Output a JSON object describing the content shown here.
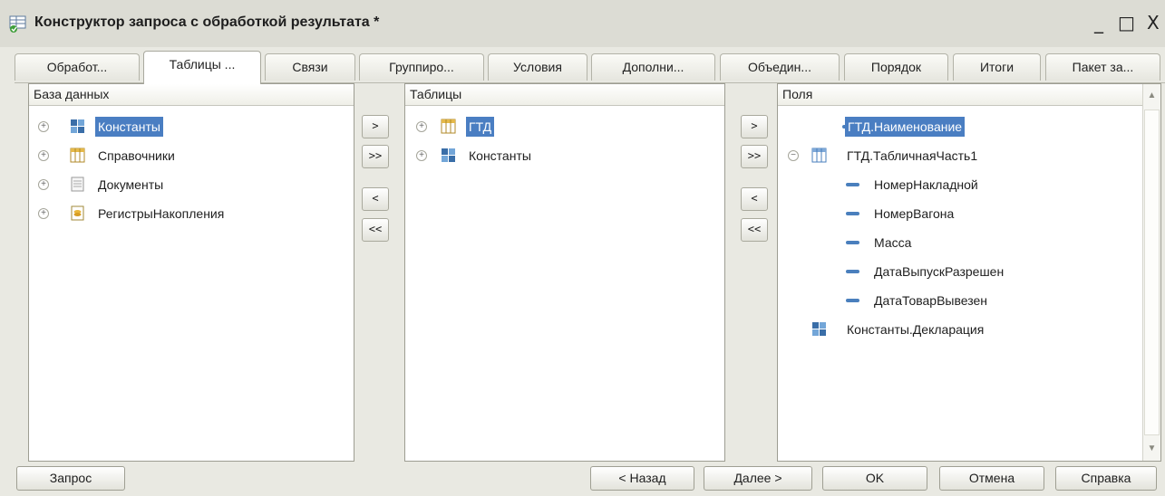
{
  "window": {
    "title": "Конструктор запроса с обработкой результата *",
    "minimize": "_",
    "maximize": "□",
    "close": "X"
  },
  "tabs": [
    {
      "label": "Обработ...",
      "active": false
    },
    {
      "label": "Таблицы ...",
      "active": true
    },
    {
      "label": "Связи",
      "active": false
    },
    {
      "label": "Группиро...",
      "active": false
    },
    {
      "label": "Условия",
      "active": false
    },
    {
      "label": "Дополни...",
      "active": false
    },
    {
      "label": "Объедин...",
      "active": false
    },
    {
      "label": "Порядок",
      "active": false
    },
    {
      "label": "Итоги",
      "active": false
    },
    {
      "label": "Пакет за...",
      "active": false
    }
  ],
  "database_panel": {
    "header": "База данных",
    "items": [
      {
        "label": "Константы",
        "icon": "constants-icon",
        "selected": true
      },
      {
        "label": "Справочники",
        "icon": "catalog-icon",
        "selected": false
      },
      {
        "label": "Документы",
        "icon": "document-icon",
        "selected": false
      },
      {
        "label": "РегистрыНакопления",
        "icon": "register-icon",
        "selected": false
      }
    ]
  },
  "tables_panel": {
    "header": "Таблицы",
    "items": [
      {
        "label": "ГТД",
        "icon": "catalog-icon",
        "selected": true
      },
      {
        "label": "Константы",
        "icon": "constants-icon",
        "selected": false
      }
    ]
  },
  "fields_panel": {
    "header": "Поля",
    "items": [
      {
        "label": "ГТД.Наименование",
        "icon": "field-icon",
        "selected": true
      },
      {
        "label": "ГТД.ТабличнаяЧасть1",
        "icon": "table-part-icon",
        "selected": false
      },
      {
        "label": "НомерНакладной",
        "icon": "field-icon",
        "selected": false
      },
      {
        "label": "НомерВагона",
        "icon": "field-icon",
        "selected": false
      },
      {
        "label": "Масса",
        "icon": "field-icon",
        "selected": false
      },
      {
        "label": "ДатаВыпускРазрешен",
        "icon": "field-icon",
        "selected": false
      },
      {
        "label": "ДатаТоварВывезен",
        "icon": "field-icon",
        "selected": false
      },
      {
        "label": "Константы.Декларация",
        "icon": "constants-icon",
        "selected": false
      }
    ]
  },
  "transfer_buttons": {
    "add": ">",
    "add_all": ">>",
    "remove": "<",
    "remove_all": "<<"
  },
  "scrollbar": {
    "up": "▲",
    "down": "▼"
  },
  "footer": {
    "query": "Запрос",
    "back": "< Назад",
    "next": "Далее >",
    "ok": "OK",
    "cancel": "Отмена",
    "help": "Справка"
  },
  "colors": {
    "selection": "#4a7ec2",
    "window_bg": "#e9e9e2"
  }
}
